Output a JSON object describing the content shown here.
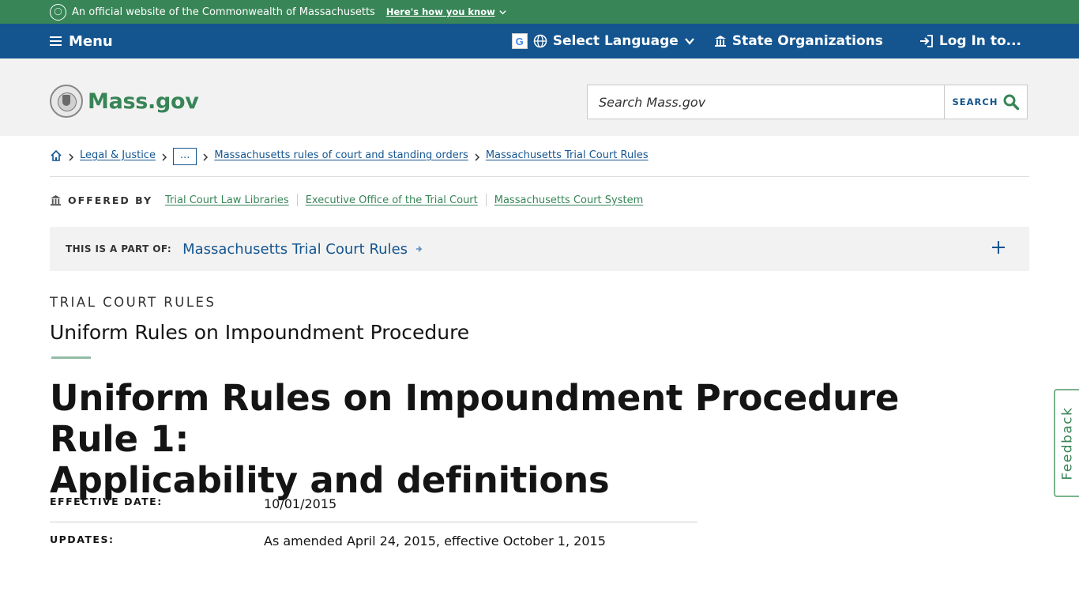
{
  "official_banner": {
    "text": "An official website of the Commonwealth of Massachusetts",
    "how_label": "Here's how you know"
  },
  "navbar": {
    "menu_label": "Menu",
    "language_label": "Select Language",
    "state_orgs_label": "State Organizations",
    "login_label": "Log In to..."
  },
  "header": {
    "logo_text": "Mass.gov",
    "search_placeholder": "Search Mass.gov",
    "search_button": "SEARCH"
  },
  "breadcrumbs": {
    "items": [
      "Legal & Justice",
      "...",
      "Massachusetts rules of court and standing orders",
      "Massachusetts Trial Court Rules"
    ]
  },
  "offered_by": {
    "label": "OFFERED BY",
    "orgs": [
      "Trial Court Law Libraries",
      "Executive Office of the Trial Court",
      "Massachusetts Court System"
    ]
  },
  "part_of": {
    "label": "THIS IS A PART OF:",
    "link": "Massachusetts Trial Court Rules"
  },
  "page": {
    "category": "TRIAL COURT RULES",
    "subtitle": "Uniform Rules on Impoundment Procedure",
    "title_line1": "Uniform Rules on Impoundment Procedure Rule 1:",
    "title_line2": "Applicability and definitions"
  },
  "meta": {
    "effective_label": "EFFECTIVE DATE:",
    "effective_value": "10/01/2015",
    "updates_label": "UPDATES:",
    "updates_value": "As amended April 24, 2015, effective October 1, 2015"
  },
  "feedback_label": "Feedback",
  "colors": {
    "green": "#388557",
    "blue": "#14558f",
    "gray_bg": "#f2f2f2"
  }
}
